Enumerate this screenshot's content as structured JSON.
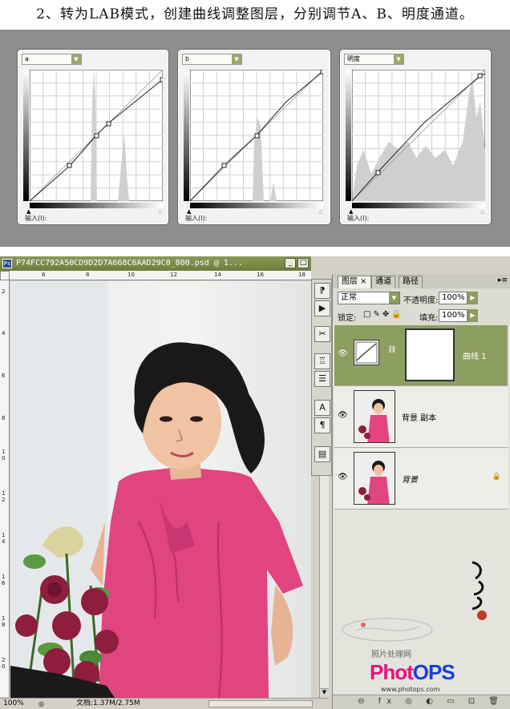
{
  "header": {
    "title": "2、转为LAB模式，创建曲线调整图层，分别调节A、B、明度通道。"
  },
  "curve_panels": [
    {
      "channel": "a",
      "input_label": "输入(I):"
    },
    {
      "channel": "b",
      "input_label": "输入(I):"
    },
    {
      "channel": "明度",
      "input_label": "输入(I):"
    }
  ],
  "document": {
    "title": "P74FCC792A50CD9D2D7A668C6AAD29C0_800.psd @ 1...",
    "buttons": {
      "minimize": "_",
      "maximize": "□"
    },
    "ruler_h_ticks": [
      "6",
      "8",
      "10",
      "12",
      "14",
      "16",
      "18"
    ],
    "ruler_v_ticks": [
      "2",
      "4",
      "6",
      "8",
      "1 0",
      "1 2",
      "1 4",
      "1 6",
      "1 8",
      "2 0"
    ],
    "zoom": "100%",
    "doc_info": "文档:1.37M/2.75M"
  },
  "tools": [
    "⁋",
    "▶",
    "✂",
    "♖",
    "☰",
    "A",
    "¶",
    "▤"
  ],
  "layers_panel": {
    "tabs": [
      "图层 ×",
      "通道",
      "路径"
    ],
    "active_tab": 0,
    "blend_mode": "正常",
    "opacity_label": "不透明度:",
    "opacity_value": "100%",
    "lock_label": "锁定:",
    "fill_label": "填充:",
    "fill_value": "100%",
    "layers": [
      {
        "name": "曲线 1",
        "type": "adjustment",
        "selected": true
      },
      {
        "name": "背景 副本",
        "type": "image",
        "selected": false
      },
      {
        "name": "背景",
        "type": "image",
        "selected": false,
        "locked": true
      }
    ],
    "bottom_icons": "⊖ fx ◎ ◐ ▭ ⊡ 🗑"
  },
  "watermark": {
    "site_cn": "照片处理网",
    "brand": "PhotoPS",
    "url": "www.photops.com"
  },
  "colors": {
    "panel_accent": "#8d9e61",
    "dress_pink": "#e0457f"
  }
}
